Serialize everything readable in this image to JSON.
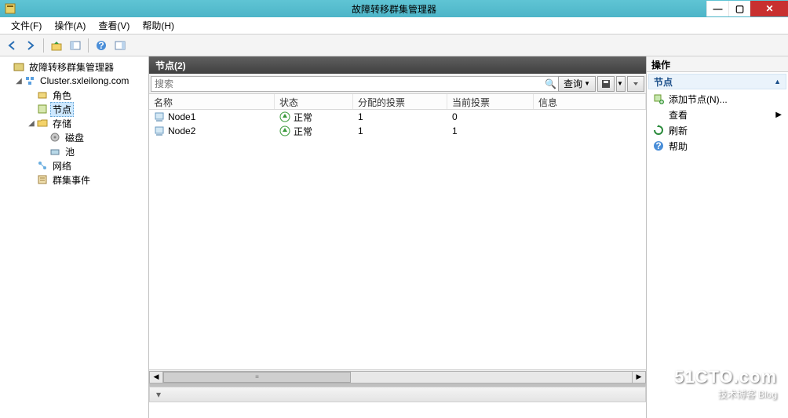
{
  "window": {
    "title": "故障转移群集管理器"
  },
  "menu": {
    "file": "文件(F)",
    "action": "操作(A)",
    "view": "查看(V)",
    "help": "帮助(H)"
  },
  "tree": {
    "root": "故障转移群集管理器",
    "cluster": "Cluster.sxleilong.com",
    "roles": "角色",
    "nodes": "节点",
    "storage": "存储",
    "disks": "磁盘",
    "pools": "池",
    "networks": "网络",
    "events": "群集事件"
  },
  "center": {
    "header": "节点(2)",
    "search_placeholder": "搜索",
    "query_btn": "查询",
    "columns": {
      "name": "名称",
      "status": "状态",
      "assigned": "分配的投票",
      "current": "当前投票",
      "info": "信息"
    },
    "rows": [
      {
        "name": "Node1",
        "status": "正常",
        "assigned": "1",
        "current": "0",
        "info": ""
      },
      {
        "name": "Node2",
        "status": "正常",
        "assigned": "1",
        "current": "1",
        "info": ""
      }
    ]
  },
  "actions": {
    "title": "操作",
    "section": "节点",
    "add_node": "添加节点(N)...",
    "view": "查看",
    "refresh": "刷新",
    "help": "帮助"
  },
  "watermark": {
    "big": "51CTO.com",
    "sub": "技术博客  Blog"
  }
}
